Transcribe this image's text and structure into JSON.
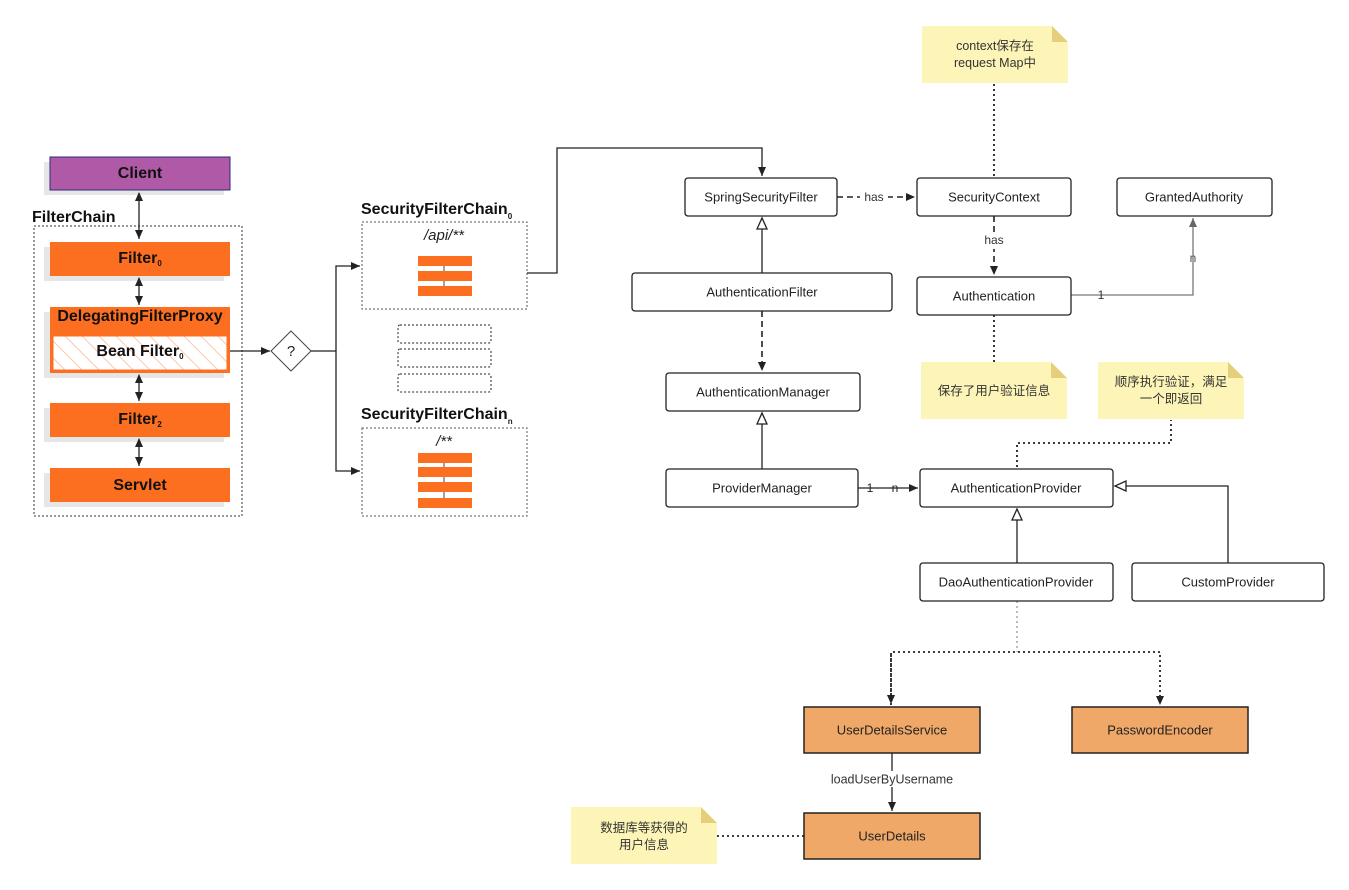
{
  "left": {
    "client": "Client",
    "filter_chain": "FilterChain",
    "filter0": "Filter",
    "filter0_sub": "0",
    "dfp": "DelegatingFilterProxy",
    "bean_filter": "Bean Filter",
    "bean_filter_sub": "0",
    "filter2": "Filter",
    "filter2_sub": "2",
    "servlet": "Servlet",
    "decision": "?"
  },
  "chains": {
    "chain0_title": "SecurityFilterChain",
    "chain0_sub": "0",
    "chain0_pattern": "/api/**",
    "chainn_title": "SecurityFilterChain",
    "chainn_sub": "n",
    "chainn_pattern": "/**"
  },
  "nodes": {
    "spring_security_filter": "SpringSecurityFilter",
    "security_context": "SecurityContext",
    "granted_authority": "GrantedAuthority",
    "authentication_filter": "AuthenticationFilter",
    "authentication": "Authentication",
    "authentication_manager": "AuthenticationManager",
    "provider_manager": "ProviderManager",
    "authentication_provider": "AuthenticationProvider",
    "dao_provider": "DaoAuthenticationProvider",
    "custom_provider": "CustomProvider",
    "user_details_service": "UserDetailsService",
    "password_encoder": "PasswordEncoder",
    "user_details": "UserDetails"
  },
  "edges": {
    "has1": "has",
    "has2": "has",
    "one1": "1",
    "n1": "n",
    "one2": "1",
    "n2": "n",
    "load": "loadUserByUsername"
  },
  "notes": {
    "context_l1": "context保存在",
    "context_l2": "request Map中",
    "auth_info": "保存了用户验证信息",
    "order_l1": "顺序执行验证，满足",
    "order_l2": "一个即返回",
    "db_l1": "数据库等获得的",
    "db_l2": "用户信息"
  },
  "colors": {
    "filter": "#fd6f20",
    "client": "#b05aa7",
    "service": "#f0a868",
    "note": "#fdf5b7"
  }
}
